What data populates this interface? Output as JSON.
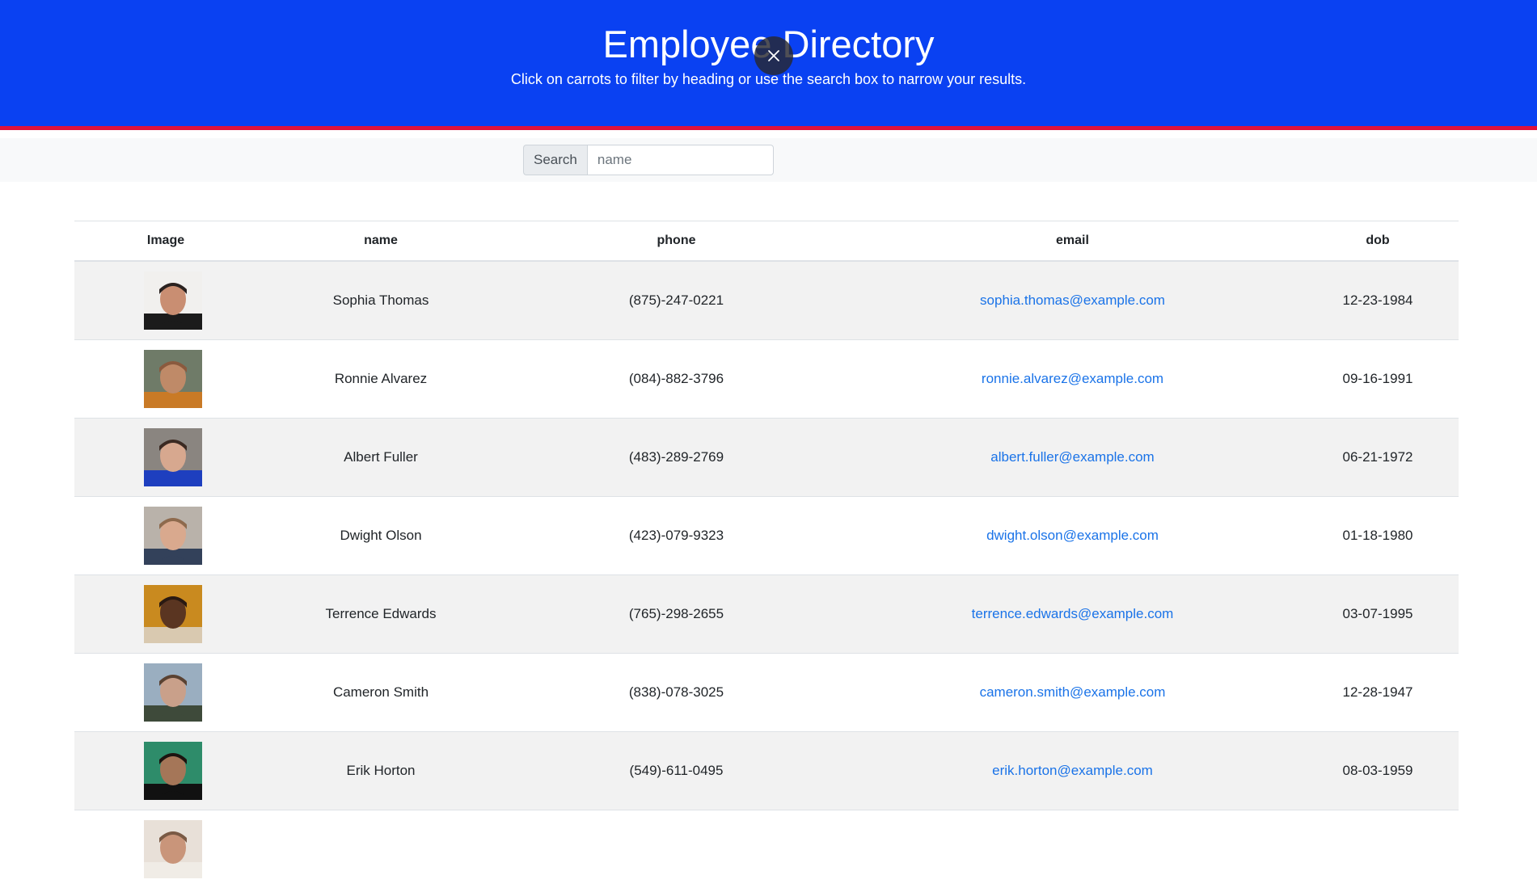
{
  "header": {
    "title": "Employee Directory",
    "subtitle": "Click on carrots to filter by heading or use the search box to narrow your results."
  },
  "search": {
    "label": "Search",
    "placeholder": "name",
    "value": ""
  },
  "table": {
    "columns": [
      "Image",
      "name",
      "phone",
      "email",
      "dob"
    ],
    "rows": [
      {
        "name": "Sophia Thomas",
        "phone": "(875)-247-0221",
        "email": "sophia.thomas@example.com",
        "dob": "12-23-1984",
        "avatar_colors": [
          "#f1f0ee",
          "#c98e72",
          "#2a2220",
          "#1b1b1b"
        ]
      },
      {
        "name": "Ronnie Alvarez",
        "phone": "(084)-882-3796",
        "email": "ronnie.alvarez@example.com",
        "dob": "09-16-1991",
        "avatar_colors": [
          "#6f7b68",
          "#bf8a68",
          "#8a5a3e",
          "#c97a26"
        ]
      },
      {
        "name": "Albert Fuller",
        "phone": "(483)-289-2769",
        "email": "albert.fuller@example.com",
        "dob": "06-21-1972",
        "avatar_colors": [
          "#8a8580",
          "#d7a88f",
          "#3b2a22",
          "#1e3fbf"
        ]
      },
      {
        "name": "Dwight Olson",
        "phone": "(423)-079-9323",
        "email": "dwight.olson@example.com",
        "dob": "01-18-1980",
        "avatar_colors": [
          "#b9b2aa",
          "#d9a98e",
          "#8e6a4d",
          "#33415a"
        ]
      },
      {
        "name": "Terrence Edwards",
        "phone": "(765)-298-2655",
        "email": "terrence.edwards@example.com",
        "dob": "03-07-1995",
        "avatar_colors": [
          "#c98a1f",
          "#5a3521",
          "#2a1a12",
          "#d9c9b0"
        ]
      },
      {
        "name": "Cameron Smith",
        "phone": "(838)-078-3025",
        "email": "cameron.smith@example.com",
        "dob": "12-28-1947",
        "avatar_colors": [
          "#9aaec0",
          "#c9a08a",
          "#5a4232",
          "#3e4a3a"
        ]
      },
      {
        "name": "Erik Horton",
        "phone": "(549)-611-0495",
        "email": "erik.horton@example.com",
        "dob": "08-03-1959",
        "avatar_colors": [
          "#2e8c6a",
          "#a57658",
          "#1c1410",
          "#111111"
        ]
      },
      {
        "name": "",
        "phone": "",
        "email": "",
        "dob": "",
        "avatar_colors": [
          "#e8e0d8",
          "#c9957a",
          "#7a5a45",
          "#f0ece6"
        ]
      }
    ]
  },
  "colors": {
    "header_bg": "#0a41f2",
    "header_border": "#e0123c",
    "link": "#1a73e8",
    "row_stripe": "#f2f2f2"
  },
  "icons": {
    "close": "close-icon"
  }
}
